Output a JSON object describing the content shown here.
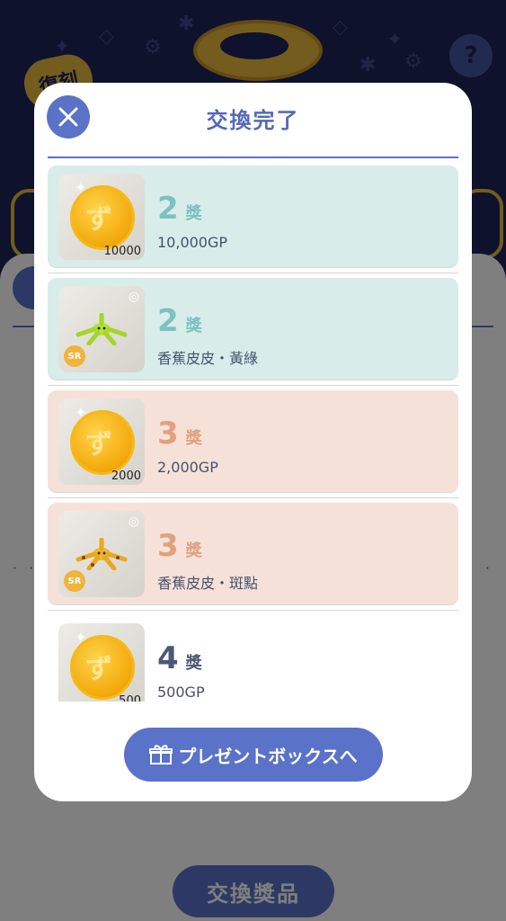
{
  "background": {
    "badge": "復刻",
    "help_label": "?",
    "dots": "· ·",
    "exchange_button": "交換獎品"
  },
  "modal": {
    "title": "交換完了",
    "close_icon": "close-icon",
    "items": [
      {
        "rank": "2",
        "suffix": "獎",
        "name": "10,000GP",
        "thumb_amount": "10000",
        "type": "coin",
        "tone": "teal"
      },
      {
        "rank": "2",
        "suffix": "獎",
        "name": "香蕉皮皮・黃綠",
        "badge": "SR",
        "type": "figure",
        "tone": "teal"
      },
      {
        "rank": "3",
        "suffix": "獎",
        "name": "2,000GP",
        "thumb_amount": "2000",
        "type": "coin",
        "tone": "peach"
      },
      {
        "rank": "3",
        "suffix": "獎",
        "name": "香蕉皮皮・斑點",
        "badge": "SR",
        "type": "figure",
        "tone": "peach"
      },
      {
        "rank": "4",
        "suffix": "獎",
        "name": "500GP",
        "thumb_amount": "500",
        "type": "coin",
        "tone": "white"
      }
    ],
    "gift_button": "プレゼントボックスへ"
  },
  "colors": {
    "accent": "#5a72c8",
    "teal": "#d8ecea",
    "peach": "#f5e1d8",
    "navy": "#1f2458"
  }
}
